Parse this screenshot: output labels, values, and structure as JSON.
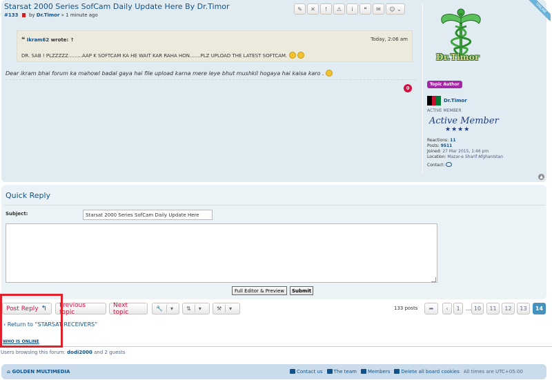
{
  "post": {
    "title": "Starsat 2000 Series SofCam Daily Update Here By Dr.Timor",
    "number": "#133",
    "by": "by",
    "author": "Dr.Timor",
    "time": "» 1 minute ago",
    "toolbar": [
      "✎",
      "✕",
      "!",
      "⚠",
      "i",
      "❝",
      "✉",
      "☺ ⌄"
    ],
    "quote": {
      "mark": "❝",
      "author": "Ikram62",
      "wrote": "wrote: ↑",
      "time": "Today, 2:06 am",
      "text": "DR. SAB ! PLZZZZZ.........AAP K SOFTCAM KA HE WAIT KAR RAHA HON.......PLZ UPLOAD THE LATEST SOFTCAM."
    },
    "body": "Dear ikram bhai forum ka mahowl badal gaya hai file upload karna mere leye bhut mushkil hogaya hai kaisa karo .",
    "reactions_badge": "0"
  },
  "profile": {
    "online_label": "ONLINE",
    "avatar_name": "Dr.Timor",
    "topic_author": "Topic Author",
    "name": "Dr.Timor",
    "rank": "ACTIVE MEMBER",
    "rank_image_text": "Active Member",
    "rank_stars": "★★★★",
    "reactions_label": "Reactions:",
    "reactions_value": "11",
    "posts_label": "Posts:",
    "posts_value": "9511",
    "joined_label": "Joined:",
    "joined_value": "27 Mar 2015, 1:46 pm",
    "location_label": "Location:",
    "location_value": "Mazar-e Sharif Afghanistan",
    "contact_label": "Contact:",
    "flag_colors": [
      "#000000",
      "#c8102e",
      "#007a36"
    ]
  },
  "quick_reply": {
    "title": "Quick Reply",
    "subject_label": "Subject:",
    "subject_value": "Starsat 2000 Series SofCam Daily Update Here",
    "full_editor_label": "Full Editor & Preview",
    "submit_label": "Submit"
  },
  "actions": {
    "post_reply": "Post Reply",
    "previous_topic": "Previous topic",
    "next_topic": "Next topic",
    "wrench_icon": "🔧",
    "sort_icon": "⇅",
    "hammer_icon": "⚒",
    "dropdown_icon": "▾"
  },
  "pagination": {
    "posts": "133 posts",
    "pages": [
      "1",
      "10",
      "11",
      "12",
      "13",
      "14"
    ],
    "ellipsis": "…",
    "active": "14"
  },
  "links": {
    "return": "Return to “STARSAT RECEIVERS”",
    "who_online": "WHO IS ONLINE",
    "browsing_prefix": "Users browsing this forum:",
    "browsing_user": "dodi2000",
    "browsing_suffix": "and 2 guests"
  },
  "footer": {
    "brand": "GOLDEN MULTIMEDIA",
    "contact": "Contact us",
    "team": "The team",
    "members": "Members",
    "delete_cookies": "Delete all board cookies",
    "timezone": "All times are UTC+05:00"
  },
  "colors": {
    "accent": "#105289",
    "badge_red": "#d31141",
    "highlight": "#e0202a",
    "topic_author": "#a428a4"
  }
}
